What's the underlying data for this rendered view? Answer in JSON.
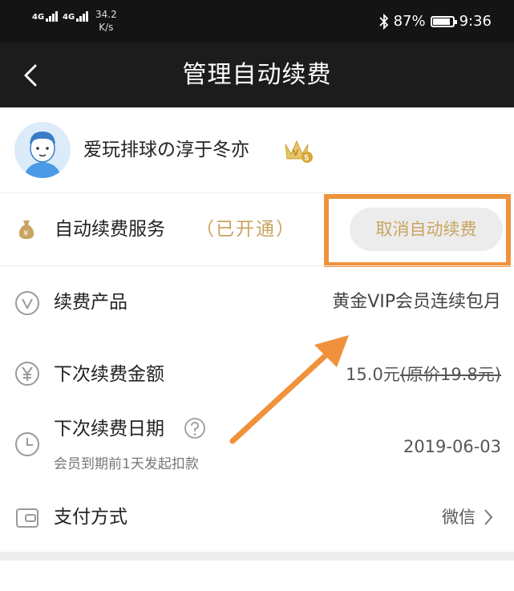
{
  "status_bar": {
    "signal1_label": "4G",
    "signal2_label": "4G",
    "net_speed_value": "34.2",
    "net_speed_unit": "K/s",
    "battery_percent": "87%",
    "battery_level": 0.87,
    "time": "9:36"
  },
  "header": {
    "title": "管理自动续费"
  },
  "profile": {
    "username": "爱玩排球の淳于冬亦",
    "vip_level": "5"
  },
  "service": {
    "label": "自动续费服务",
    "status": "（已开通）",
    "cancel_label": "取消自动续费"
  },
  "rows": {
    "product_label": "续费产品",
    "product_value": "黄金VIP会员连续包月",
    "amount_label": "下次续费金额",
    "amount_value": "15.0元",
    "amount_original_prefix": "(原价",
    "amount_original_price": "19.8元",
    "amount_original_suffix": ")",
    "date_label": "下次续费日期",
    "date_hint": "会员到期前1天发起扣款",
    "date_value": "2019-06-03",
    "payment_label": "支付方式",
    "payment_value": "微信"
  },
  "colors": {
    "accent_gold": "#c9a461",
    "highlight_orange": "#f0923b",
    "header_bg": "#1c1c1c"
  },
  "icons": [
    "back-arrow-icon",
    "money-bag-icon",
    "vip-crown-icon",
    "v-circle-icon",
    "yen-circle-icon",
    "clock-icon",
    "question-circle-icon",
    "wallet-icon",
    "chevron-right-icon",
    "bluetooth-icon",
    "battery-icon"
  ]
}
